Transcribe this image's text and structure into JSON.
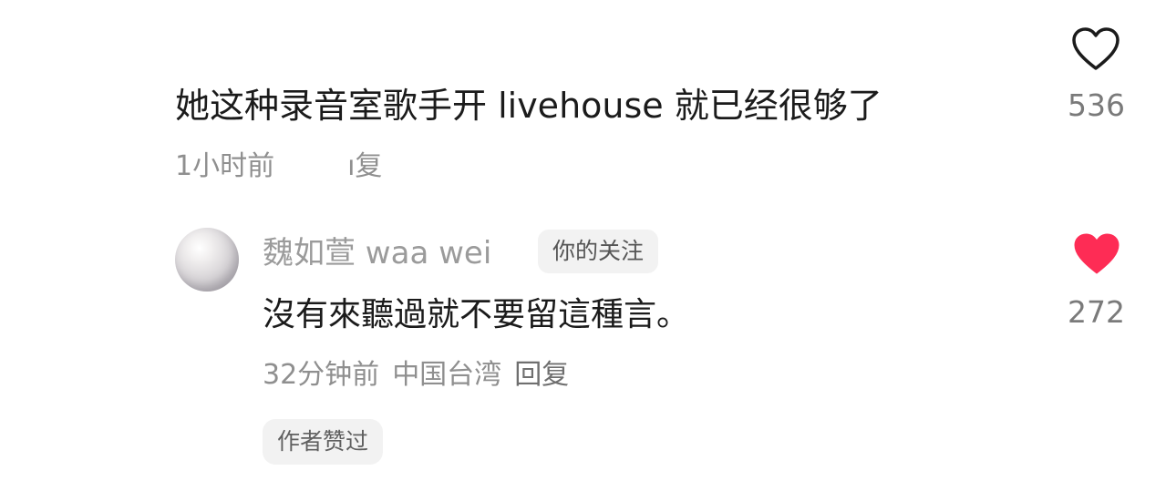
{
  "comment": {
    "text": "她这种录音室歌手开 livehouse 就已经很够了",
    "time": "1小时前",
    "reply_label": "ı复",
    "likes": "536",
    "liked": false
  },
  "reply": {
    "author": "魏如萱 waa wei",
    "badge": "你的关注",
    "text": "沒有來聽過就不要留這種言。",
    "time": "32分钟前",
    "location": "中国台湾",
    "reply_label": "回复",
    "author_liked": "作者赞过",
    "likes": "272",
    "liked": true
  },
  "colors": {
    "heart_liked": "#fe2c55",
    "heart_outline": "#1b1b1b",
    "meta_gray": "#8f8f8f"
  },
  "icons": {
    "like_outline": "heart-outline-icon",
    "like_filled": "heart-filled-icon",
    "avatar": "pearl-avatar"
  }
}
